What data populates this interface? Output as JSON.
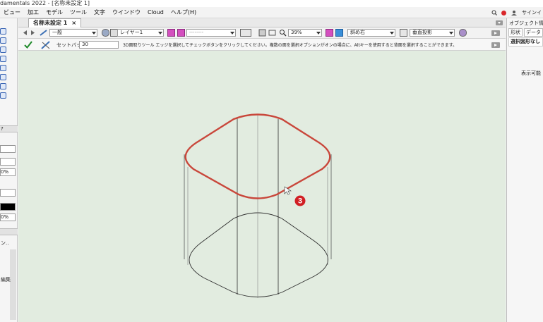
{
  "window": {
    "title": "damentals 2022 - [名称未設定 1]"
  },
  "menu": {
    "items": [
      "ビュー",
      "加工",
      "モデル",
      "ツール",
      "文字",
      "ウインドウ",
      "Cloud",
      "ヘルプ(H)"
    ],
    "signin_label": "サインイ"
  },
  "document_tab": {
    "label": "名称未設定 1",
    "close": "×"
  },
  "toolbar": {
    "class_value": "一般",
    "layer_value": "レイヤー1",
    "sheet_value": "--------",
    "zoom_value": "39%",
    "view_value": "斜め右",
    "projection_value": "垂直投影"
  },
  "mode_bar": {
    "setback_label": "セットバック:",
    "setback_value": "30",
    "help_text": "3D面取りツール エッジを選択してチェックボタンをクリックしてください。複数の面を選択オプションがオンの場合に、Altキーを使用すると背面を選択することができます。"
  },
  "annotation": {
    "step_number": "3",
    "color": "#d11f24"
  },
  "right_panel": {
    "title": "オブジェクト情報",
    "tabs": [
      "形状",
      "データ"
    ],
    "selection_label": "選択図形なし",
    "info_text": "表示可能"
  },
  "left_panel": {
    "help_label": "?",
    "percent_label_1": "0%",
    "percent_label_2": "0%",
    "truncated_label": "ン..",
    "edit_label": "編集"
  },
  "colors": {
    "canvas": "#e2ece0",
    "highlight_edge": "#c9473b",
    "model_lines": "#2e2e2e"
  },
  "icons": [
    "back-arrow-icon",
    "forward-arrow-icon",
    "check-icon",
    "chamfer-tool-icon",
    "zoom-icon",
    "notification-icon"
  ]
}
